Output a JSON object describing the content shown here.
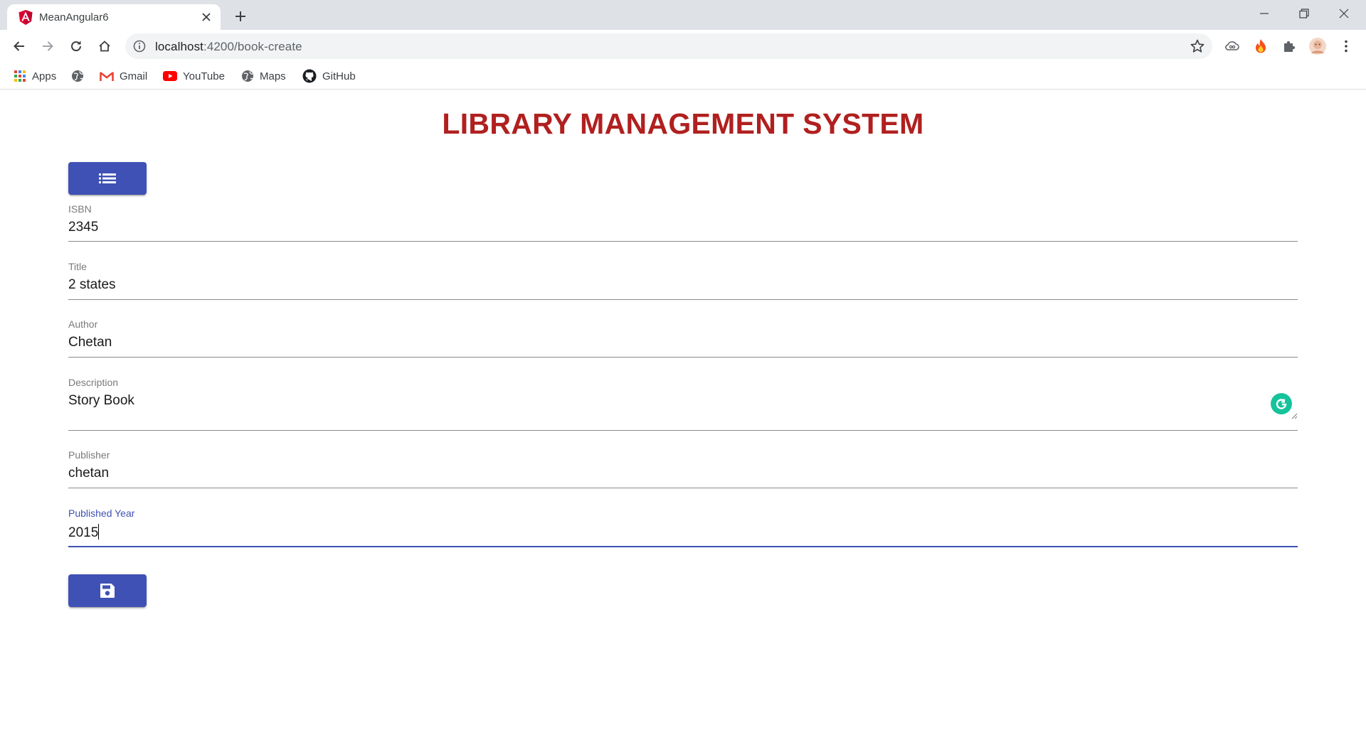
{
  "browser": {
    "tab_title": "MeanAngular6",
    "url_host": "localhost",
    "url_path": ":4200/book-create",
    "bookmarks": [
      {
        "label": "Apps",
        "icon": "apps-grid-icon"
      },
      {
        "label": "",
        "icon": "globe-icon"
      },
      {
        "label": "Gmail",
        "icon": "gmail-icon"
      },
      {
        "label": "YouTube",
        "icon": "youtube-icon"
      },
      {
        "label": "Maps",
        "icon": "globe-icon"
      },
      {
        "label": "GitHub",
        "icon": "github-icon"
      }
    ]
  },
  "page": {
    "title": "LIBRARY MANAGEMENT SYSTEM",
    "list_button_icon": "list-icon",
    "save_button_icon": "save-icon"
  },
  "form": {
    "isbn": {
      "label": "ISBN",
      "value": "2345"
    },
    "title": {
      "label": "Title",
      "value": "2 states"
    },
    "author": {
      "label": "Author",
      "value": "Chetan"
    },
    "description": {
      "label": "Description",
      "value": "Story Book"
    },
    "publisher": {
      "label": "Publisher",
      "value": "chetan"
    },
    "published_year": {
      "label": "Published Year",
      "value": "2015"
    }
  },
  "colors": {
    "title": "#b0201f",
    "primary": "#3f51b5",
    "grammarly": "#15c39a"
  }
}
